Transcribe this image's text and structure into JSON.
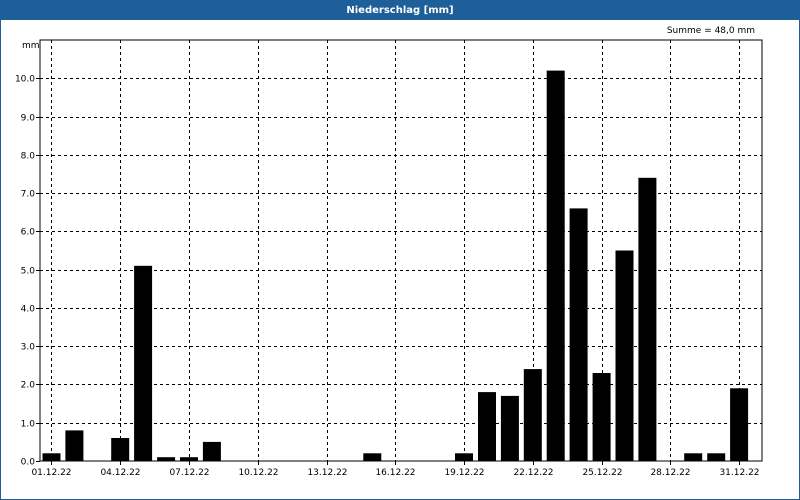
{
  "window": {
    "title": "Niederschlag [mm]"
  },
  "colors": {
    "titlebar": "#1f5f99",
    "bar": "#000000",
    "grid": "#000000"
  },
  "chart_data": {
    "type": "bar",
    "title": "Niederschlag [mm]",
    "ylabel": "mm",
    "xlabel": "",
    "annotation": "Summe = 48,0 mm",
    "ylim": [
      0,
      11
    ],
    "grid": true,
    "y_ticks": [
      0.0,
      1.0,
      2.0,
      3.0,
      4.0,
      5.0,
      6.0,
      7.0,
      8.0,
      9.0,
      10.0
    ],
    "y_tick_labels": [
      "0.0",
      "1.0",
      "2.0",
      "3.0",
      "4.0",
      "5.0",
      "6.0",
      "7.0",
      "8.0",
      "9.0",
      "10.0"
    ],
    "x_tick_labels": [
      "01.12.22",
      "04.12.22",
      "07.12.22",
      "10.12.22",
      "13.12.22",
      "16.12.22",
      "19.12.22",
      "22.12.22",
      "25.12.22",
      "28.12.22",
      "31.12.22"
    ],
    "x_tick_positions": [
      1,
      4,
      7,
      10,
      13,
      16,
      19,
      22,
      25,
      28,
      31
    ],
    "x_range": [
      0.5,
      32
    ],
    "days": [
      1,
      2,
      3,
      4,
      5,
      6,
      7,
      8,
      9,
      10,
      11,
      12,
      13,
      14,
      15,
      16,
      17,
      18,
      19,
      20,
      21,
      22,
      23,
      24,
      25,
      26,
      27,
      28,
      29,
      30,
      31
    ],
    "values": [
      0.2,
      0.8,
      0.0,
      0.6,
      5.1,
      0.1,
      0.1,
      0.5,
      0.0,
      0.0,
      0.0,
      0.0,
      0.0,
      0.0,
      0.2,
      0.0,
      0.0,
      0.0,
      0.2,
      1.8,
      1.7,
      2.4,
      10.2,
      6.6,
      2.3,
      5.5,
      7.4,
      0.0,
      0.2,
      0.2,
      1.9
    ]
  }
}
